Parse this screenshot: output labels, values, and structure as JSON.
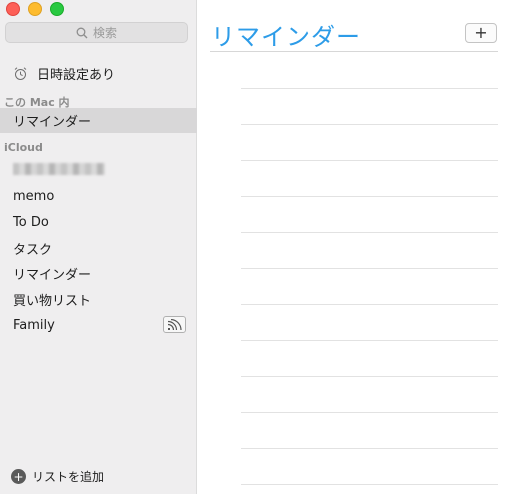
{
  "window": {
    "controls": [
      "close",
      "minimize",
      "zoom"
    ]
  },
  "search": {
    "placeholder": "検索",
    "icon": "magnifier-icon"
  },
  "sidebar": {
    "scheduled": {
      "label": "日時設定あり",
      "icon": "alarm-clock-icon"
    },
    "local_section": {
      "title": "この Mac 内"
    },
    "local_items": [
      {
        "label": "リマインダー",
        "selected": true
      }
    ],
    "icloud_section": {
      "title": "iCloud"
    },
    "icloud_items": [
      {
        "label": "memo"
      },
      {
        "label": "To Do"
      },
      {
        "label": "タスク"
      },
      {
        "label": "リマインダー"
      },
      {
        "label": "買い物リスト"
      },
      {
        "label": "Family",
        "badge_icon": "shared-list-icon"
      }
    ],
    "add_list": {
      "label": "リストを追加",
      "icon": "plus-circle-icon"
    }
  },
  "main": {
    "title": "リマインダー",
    "add_button": {
      "label": "+"
    },
    "empty_rows": 12
  },
  "colors": {
    "accent": "#2d9ce8",
    "sidebar_bg": "#efeeef",
    "selected_row": "#d8d7d8"
  }
}
